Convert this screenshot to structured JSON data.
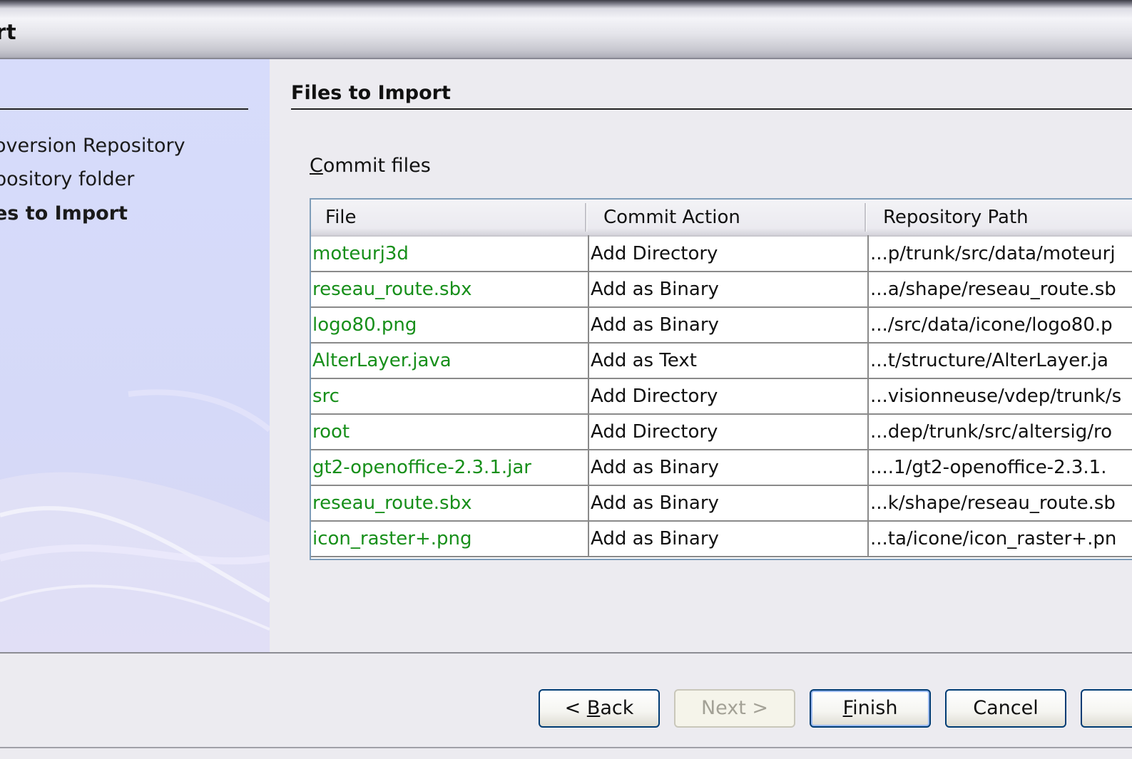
{
  "window": {
    "title": "rt"
  },
  "steps": {
    "items": [
      {
        "label": "oversion Repository",
        "current": false
      },
      {
        "label": "pository folder",
        "current": false
      },
      {
        "label": "es to Import",
        "current": true
      }
    ]
  },
  "main": {
    "section_title": "Files to Import",
    "commit_label_mnemonic": "C",
    "commit_label_rest": "ommit files",
    "table": {
      "columns": [
        "File",
        "Commit Action",
        "Repository Path"
      ],
      "rows": [
        {
          "file": "moteurj3d",
          "action": "Add Directory",
          "path": "...p/trunk/src/data/moteurj"
        },
        {
          "file": "reseau_route.sbx",
          "action": "Add as Binary",
          "path": "...a/shape/reseau_route.sb"
        },
        {
          "file": "logo80.png",
          "action": "Add as Binary",
          "path": ".../src/data/icone/logo80.p"
        },
        {
          "file": "AlterLayer.java",
          "action": "Add as Text",
          "path": "...t/structure/AlterLayer.ja"
        },
        {
          "file": "src",
          "action": "Add Directory",
          "path": "...visionneuse/vdep/trunk/s"
        },
        {
          "file": "root",
          "action": "Add Directory",
          "path": "...dep/trunk/src/altersig/ro"
        },
        {
          "file": "gt2-openoffice-2.3.1.jar",
          "action": "Add as Binary",
          "path": "....1/gt2-openoffice-2.3.1."
        },
        {
          "file": "reseau_route.sbx",
          "action": "Add as Binary",
          "path": "...k/shape/reseau_route.sb"
        },
        {
          "file": "icon_raster+.png",
          "action": "Add as Binary",
          "path": "...ta/icone/icon_raster+.pn"
        }
      ]
    }
  },
  "buttons": {
    "back_prefix": "< ",
    "back_mnemonic": "B",
    "back_rest": "ack",
    "next": "Next >",
    "finish_mnemonic": "F",
    "finish_rest": "inish",
    "cancel": "Cancel",
    "extra": ""
  },
  "colors": {
    "file_text": "#178f1a",
    "button_border": "#003c74",
    "steps_panel": "#d7dcfb"
  }
}
